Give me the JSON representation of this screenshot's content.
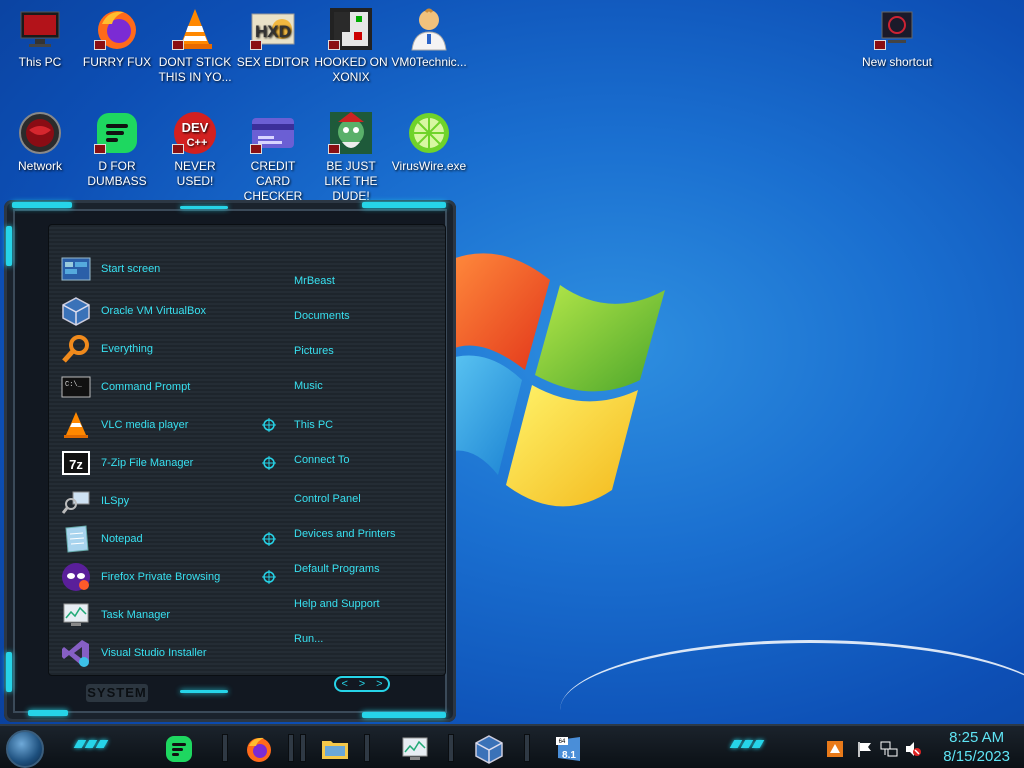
{
  "desktop": {
    "icons": [
      {
        "label": "This PC"
      },
      {
        "label": "FURRY FUX"
      },
      {
        "label": "DONT STICK THIS IN YO..."
      },
      {
        "label": "SEX EDITOR"
      },
      {
        "label": "HOOKED ON XONIX"
      },
      {
        "label": "VM0Technic..."
      },
      {
        "label": "New shortcut"
      },
      {
        "label": "Network"
      },
      {
        "label": "D FOR DUMBASS"
      },
      {
        "label": "NEVER USED!"
      },
      {
        "label": "CREDIT CARD CHECKER"
      },
      {
        "label": "BE JUST LIKE THE DUDE!"
      },
      {
        "label": "VirusWire.exe"
      }
    ],
    "dev_icon_text": "DEV",
    "dev_icon_sub": "C++",
    "sevenzip_badge": "7z",
    "hxd_letters": "HXD"
  },
  "start_menu": {
    "programs": [
      {
        "label": "Start screen"
      },
      {
        "label": "Oracle VM VirtualBox"
      },
      {
        "label": "Everything"
      },
      {
        "label": "Command Prompt"
      },
      {
        "label": "VLC media player"
      },
      {
        "label": "7-Zip File Manager"
      },
      {
        "label": "ILSpy"
      },
      {
        "label": "Notepad"
      },
      {
        "label": "Firefox Private Browsing"
      },
      {
        "label": "Task Manager"
      },
      {
        "label": "Visual Studio Installer"
      }
    ],
    "cmd_icon_text": "C:\\_",
    "right_items": [
      {
        "label": "MrBeast"
      },
      {
        "label": "Documents"
      },
      {
        "label": "Pictures"
      },
      {
        "label": "Music"
      },
      {
        "label": "This PC"
      },
      {
        "label": "Connect To"
      },
      {
        "label": "Control Panel"
      },
      {
        "label": "Devices and Printers"
      },
      {
        "label": "Default Programs"
      },
      {
        "label": "Help and Support"
      },
      {
        "label": "Run..."
      }
    ],
    "system_label": "SYSTEM",
    "power_arrows": [
      "<",
      ">",
      ">"
    ]
  },
  "taskbar": {
    "win81_badge_top": "64",
    "win81_badge": "8.1",
    "time": "8:25 AM",
    "date": "8/15/2023"
  },
  "colors": {
    "accent": "#26d4e8",
    "menu_text": "#38e0f0"
  }
}
